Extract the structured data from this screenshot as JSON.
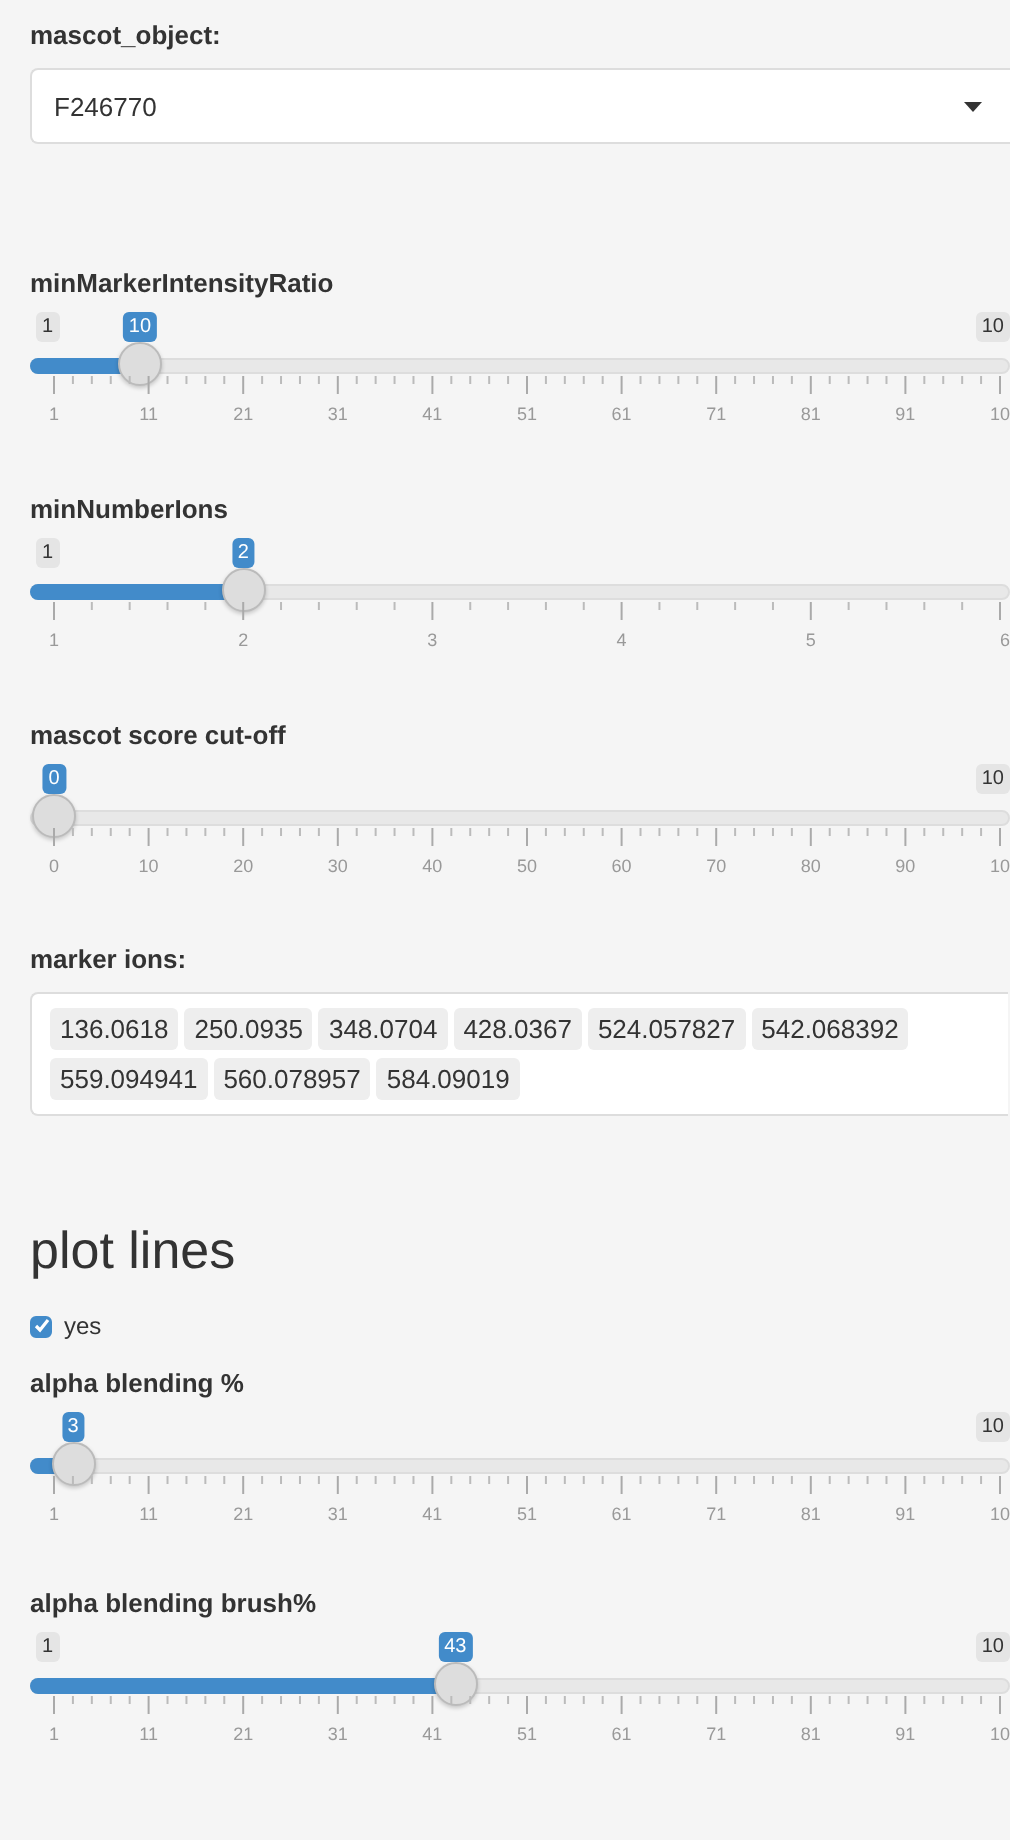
{
  "select": {
    "label": "mascot_object:",
    "value": "F246770"
  },
  "sliders_top": [
    {
      "label": "minMarkerIntensityRatio",
      "min_label": "1",
      "max_label": "10",
      "value": "10",
      "level": 0.0909,
      "ticks": [
        "1",
        "11",
        "21",
        "31",
        "41",
        "51",
        "61",
        "71",
        "81",
        "91",
        "10"
      ]
    },
    {
      "label": "minNumberIons",
      "min_label": "1",
      "value": "2",
      "level": 0.2,
      "ticks": [
        "1",
        "2",
        "3",
        "4",
        "5",
        "6"
      ]
    },
    {
      "label": "mascot score cut-off",
      "max_label": "10",
      "value": "0",
      "level": 0,
      "ticks": [
        "0",
        "10",
        "20",
        "30",
        "40",
        "50",
        "60",
        "70",
        "80",
        "90",
        "10"
      ]
    }
  ],
  "marker_ions": {
    "label": "marker ions:",
    "items": [
      "136.0618",
      "250.0935",
      "348.0704",
      "428.0367",
      "524.057827",
      "542.068392",
      "559.094941",
      "560.078957",
      "584.09019"
    ]
  },
  "heading": "plot lines",
  "checkbox": {
    "label": "yes",
    "checked": true
  },
  "sliders_bottom": [
    {
      "label": "alpha blending %",
      "max_label": "10",
      "value": "3",
      "level": 0.0202,
      "ticks": [
        "1",
        "11",
        "21",
        "31",
        "41",
        "51",
        "61",
        "71",
        "81",
        "91",
        "10"
      ]
    },
    {
      "label": "alpha blending brush%",
      "min_label": "1",
      "max_label": "10",
      "value": "43",
      "level": 0.4242,
      "ticks": [
        "1",
        "11",
        "21",
        "31",
        "41",
        "51",
        "61",
        "71",
        "81",
        "91",
        "10"
      ]
    }
  ]
}
